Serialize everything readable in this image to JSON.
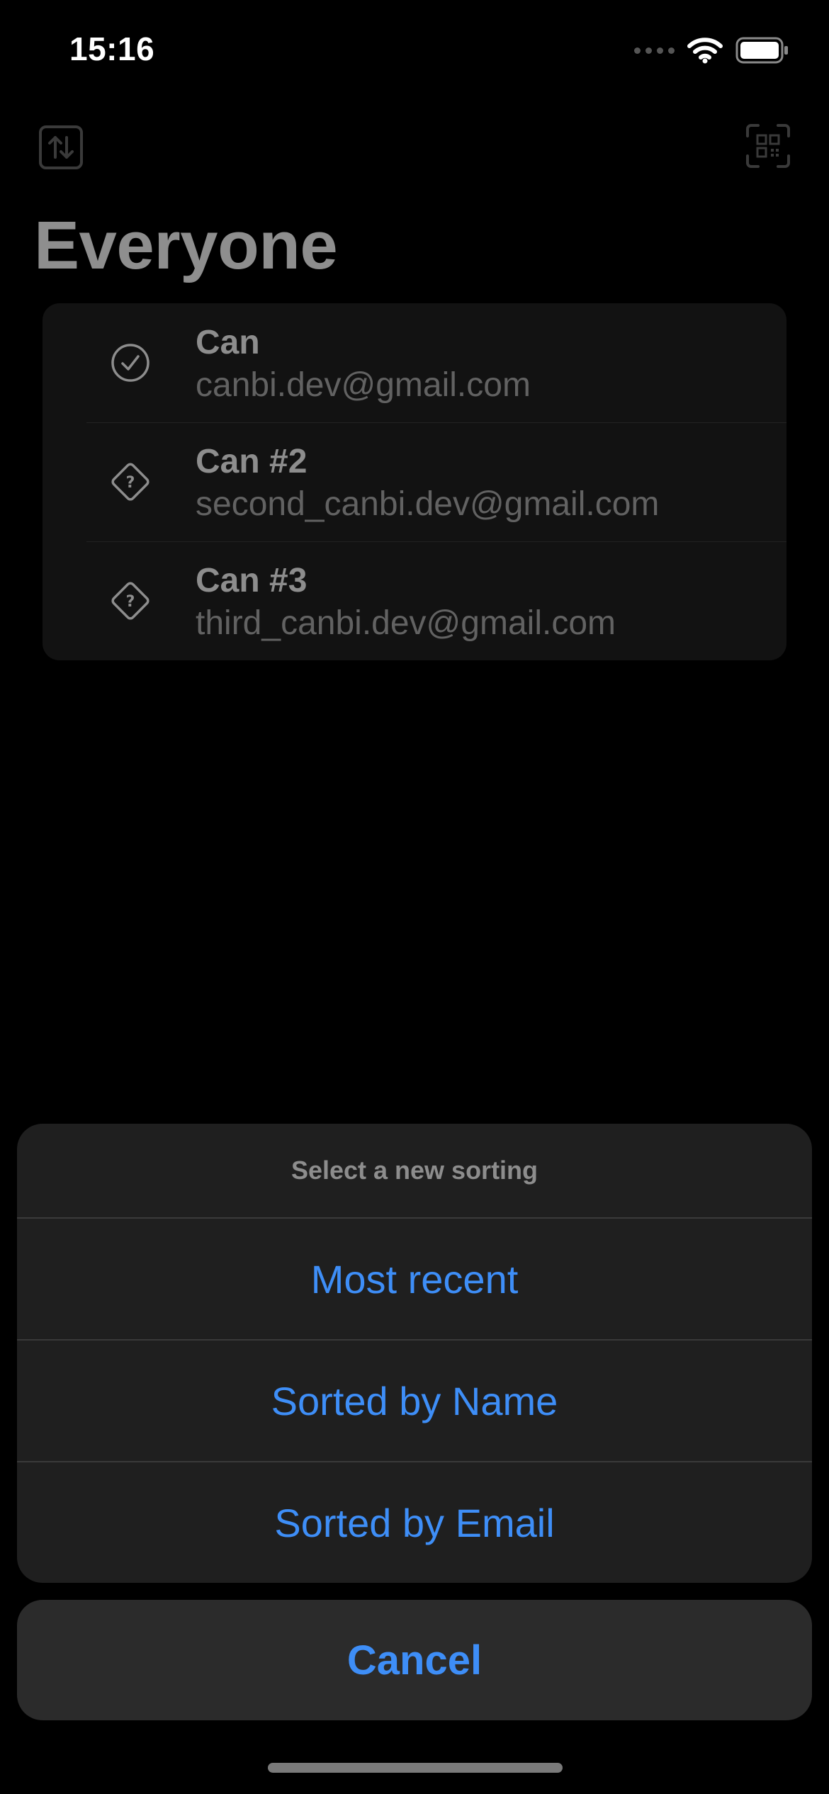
{
  "status_bar": {
    "time": "15:16"
  },
  "header": {
    "title": "Everyone"
  },
  "users": [
    {
      "name": "Can",
      "email": "canbi.dev@gmail.com",
      "status": "verified",
      "icon": "checkmark-circle-icon"
    },
    {
      "name": "Can #2",
      "email": "second_canbi.dev@gmail.com",
      "status": "unknown",
      "icon": "question-diamond-icon"
    },
    {
      "name": "Can #3",
      "email": "third_canbi.dev@gmail.com",
      "status": "unknown",
      "icon": "question-diamond-icon"
    }
  ],
  "action_sheet": {
    "title": "Select a new sorting",
    "options": [
      "Most recent",
      "Sorted by Name",
      "Sorted by Email"
    ],
    "cancel_label": "Cancel"
  },
  "colors": {
    "background": "#000000",
    "accent": "#3e8ef7",
    "sheet_background": "#1f1f1f",
    "cancel_background": "#2b2b2b"
  },
  "icons": {
    "sort": "arrows-up-down-icon",
    "qr": "qr-code-scan-icon",
    "wifi": "wifi-icon",
    "battery": "battery-icon",
    "signal": "signal-icon"
  }
}
